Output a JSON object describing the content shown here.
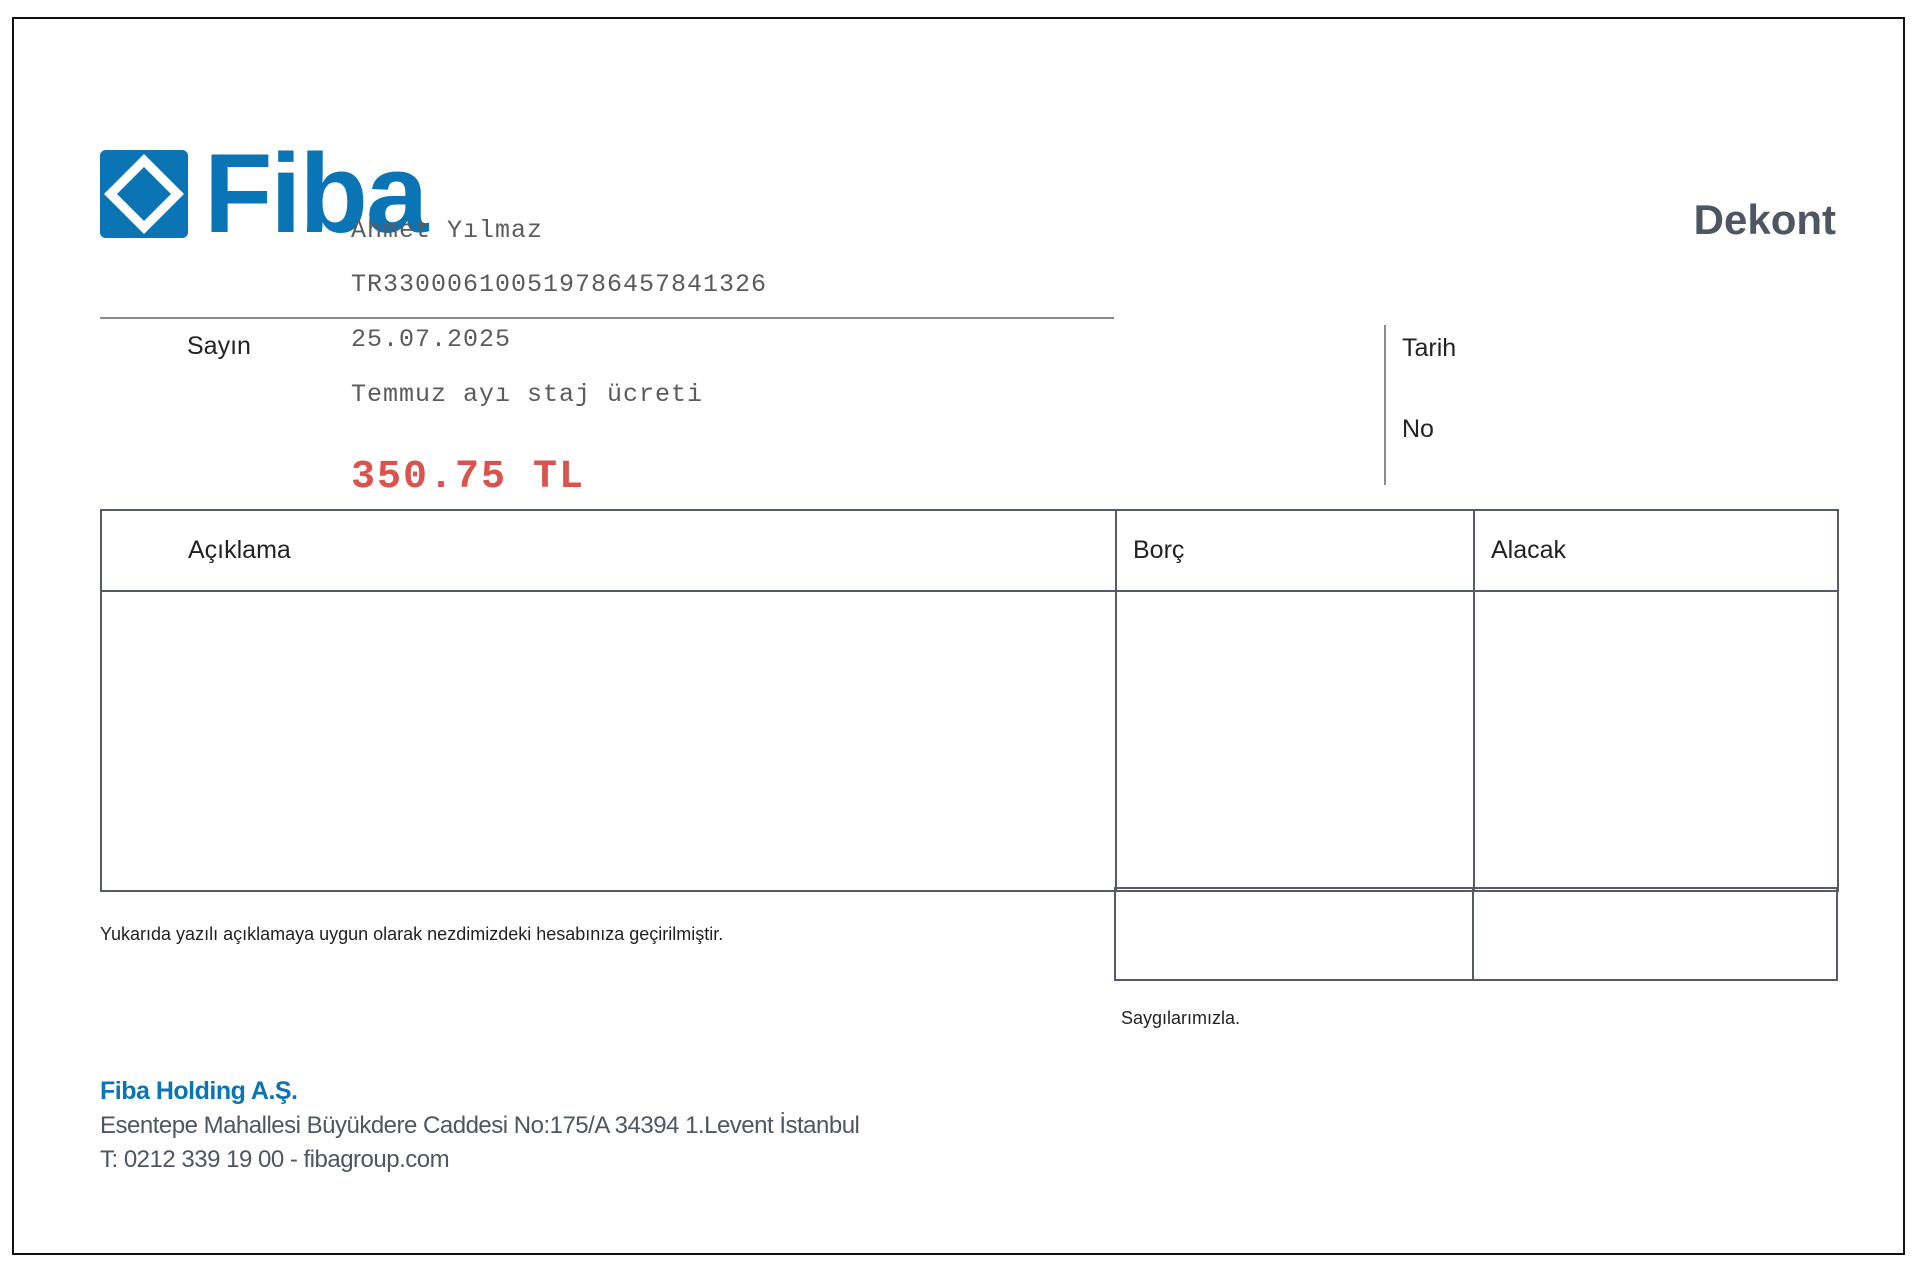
{
  "document": {
    "title": "Dekont",
    "logo_text": "Fiba"
  },
  "recipient": {
    "salutation_label": "Sayın",
    "name": "Ahmet Yılmaz",
    "iban": "TR330006100519786457841326",
    "date": "25.07.2025",
    "description": "Temmuz ayı staj ücreti",
    "amount": "350.75 TL"
  },
  "meta": {
    "date_label": "Tarih",
    "no_label": "No"
  },
  "table": {
    "headers": [
      "Açıklama",
      "Borç",
      "Alacak"
    ]
  },
  "notes": {
    "statement": "Yukarıda yazılı açıklamaya uygun olarak nezdimizdeki hesabınıza geçirilmiştir.",
    "closing": "Saygılarımızla."
  },
  "footer": {
    "company": "Fiba Holding A.Ş.",
    "address": "Esentepe Mahallesi Büyükdere Caddesi No:175/A 34394 1.Levent  İstanbul",
    "contact": "T: 0212 339 19 00 - fibagroup.com"
  },
  "colors": {
    "brand": "#0a74b5",
    "amount": "#d9534f",
    "title": "#4d5661"
  },
  "icons": {
    "logo_mark": "fiba-diamond-icon"
  }
}
